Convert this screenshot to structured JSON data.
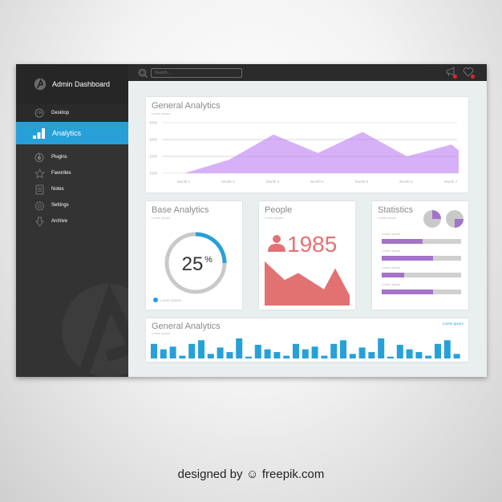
{
  "app": {
    "title": "Admin Dashboard"
  },
  "sidebar": {
    "items": [
      {
        "label": "Desktop",
        "icon": "dashboard-gauge-icon"
      },
      {
        "label": "Analytics",
        "icon": "bar-chart-icon",
        "active": true
      },
      {
        "label": "Plugins",
        "icon": "power-icon"
      },
      {
        "label": "Favorites",
        "icon": "star-icon"
      },
      {
        "label": "Notes",
        "icon": "notes-icon"
      },
      {
        "label": "Settings",
        "icon": "gear-icon"
      },
      {
        "label": "Archive",
        "icon": "arrow-down-icon"
      }
    ]
  },
  "topbar": {
    "search_placeholder": "Search...",
    "icons": [
      "megaphone-icon",
      "heart-icon"
    ]
  },
  "colors": {
    "accent": "#27a0d8",
    "purple": "#d6b1f7",
    "coral": "#e27272",
    "stat_purple": "#a372c9"
  },
  "general_analytics": {
    "title": "General Analytics",
    "subtitle": "Lorem Ipsum"
  },
  "base_analytics": {
    "title": "Base Analytics",
    "subtitle": "Lorem Ipsum",
    "percent": 25,
    "value_label": "25",
    "unit_label": "%",
    "legend_label": "Lorem Ipsum"
  },
  "people": {
    "title": "People",
    "subtitle": "Lorem Ipsum",
    "count": "1985",
    "sparkline": [
      95,
      55,
      70,
      35,
      80,
      22
    ]
  },
  "statistics": {
    "title": "Statistics",
    "subtitle": "Lorem Ipsum",
    "pies": [
      {
        "fraction": 0.25,
        "quadrant": "top-right"
      },
      {
        "fraction": 0.25,
        "quadrant": "bottom-right"
      }
    ],
    "bars": [
      {
        "label": "Lorem Ipsum",
        "value": 0.52
      },
      {
        "label": "Lorem Ipsum",
        "value": 0.65
      },
      {
        "label": "Lorem Ipsum",
        "value": 0.28
      },
      {
        "label": "Lorem Ipsum",
        "value": 0.65
      }
    ]
  },
  "general_analytics_bars": {
    "title": "General Analytics",
    "subtitle": "Lorem Ipsum",
    "legend_label": "Lorem Ipsum"
  },
  "chart_data": [
    {
      "type": "area",
      "title": "General Analytics",
      "subtitle": "Lorem Ipsum",
      "categories": [
        "Month 1",
        "Month 2",
        "Month 3",
        "Month 4",
        "Month 5",
        "Month 6",
        "Month 7"
      ],
      "values": [
        1000,
        1800,
        3300,
        2200,
        3450,
        2000,
        2700
      ],
      "trailing_value": 2350,
      "yticks": [
        1000,
        2000,
        3000,
        4000
      ],
      "ylim": [
        1000,
        4000
      ],
      "grid": true,
      "color": "#d6b1f7"
    },
    {
      "type": "bar",
      "title": "General Analytics",
      "subtitle": "Lorem Ipsum",
      "legend": "Lorem Ipsum",
      "values": [
        16,
        10,
        13,
        3,
        16,
        20,
        5,
        12,
        7,
        22,
        2,
        15,
        10,
        7,
        3,
        16,
        10,
        13,
        3,
        16,
        20,
        5,
        12,
        7,
        22,
        2,
        15,
        10,
        7,
        3,
        16,
        20,
        5
      ],
      "ylim": [
        0,
        22
      ],
      "color": "#27a0d8"
    }
  ],
  "footer": {
    "credit": "designed by",
    "brand": "freepik.com"
  }
}
